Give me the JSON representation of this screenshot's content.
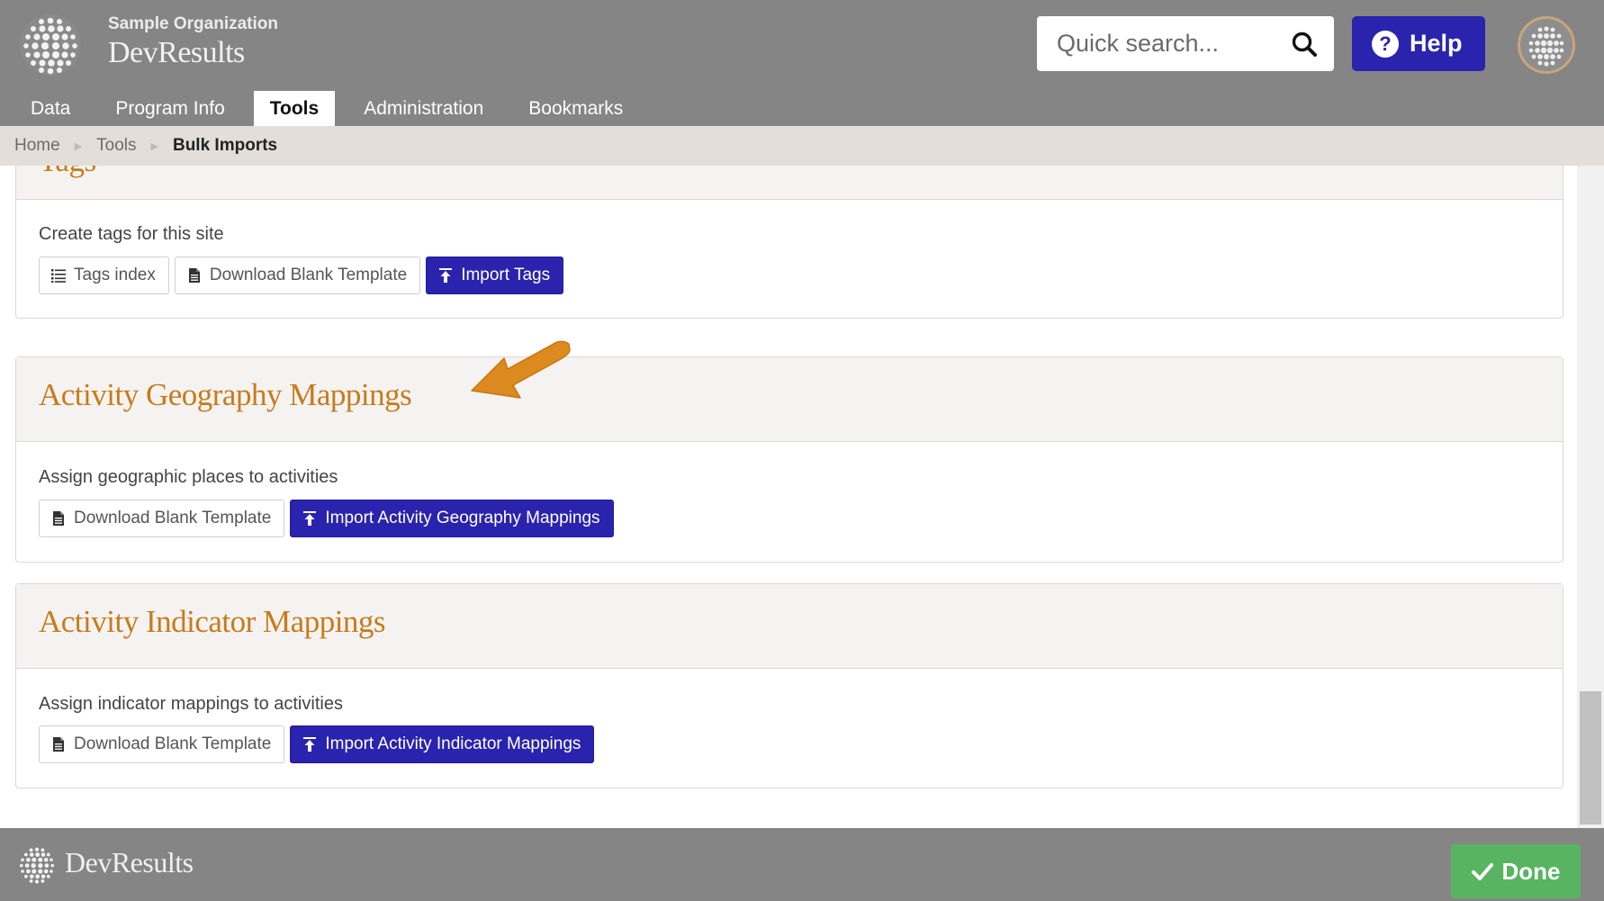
{
  "header": {
    "org_name": "Sample Organization",
    "app_name": "DevResults",
    "search_placeholder": "Quick search...",
    "help_label": "Help",
    "help_icon_glyph": "?"
  },
  "nav": {
    "tabs": [
      {
        "label": "Data",
        "active": false
      },
      {
        "label": "Program Info",
        "active": false
      },
      {
        "label": "Tools",
        "active": true
      },
      {
        "label": "Administration",
        "active": false
      },
      {
        "label": "Bookmarks",
        "active": false
      }
    ]
  },
  "breadcrumb": {
    "items": [
      "Home",
      "Tools",
      "Bulk Imports"
    ]
  },
  "sections": [
    {
      "title": "Tags",
      "description": "Create tags for this site",
      "buttons": [
        {
          "label": "Tags index",
          "icon": "list-icon",
          "style": "default"
        },
        {
          "label": "Download Blank Template",
          "icon": "file-icon",
          "style": "default"
        },
        {
          "label": "Import Tags",
          "icon": "upload-icon",
          "style": "primary"
        }
      ]
    },
    {
      "title": "Activity Geography Mappings",
      "description": "Assign geographic places to activities",
      "buttons": [
        {
          "label": "Download Blank Template",
          "icon": "file-icon",
          "style": "default"
        },
        {
          "label": "Import Activity Geography Mappings",
          "icon": "upload-icon",
          "style": "primary"
        }
      ]
    },
    {
      "title": "Activity Indicator Mappings",
      "description": "Assign indicator mappings to activities",
      "buttons": [
        {
          "label": "Download Blank Template",
          "icon": "file-icon",
          "style": "default"
        },
        {
          "label": "Import Activity Indicator Mappings",
          "icon": "upload-icon",
          "style": "primary"
        }
      ]
    }
  ],
  "footer": {
    "app_name": "DevResults",
    "done_label": "Done"
  },
  "colors": {
    "header_bg": "#858585",
    "primary": "#2a23ad",
    "section_title": "#c77b1b",
    "breadcrumb_bg": "#e3ded9",
    "done_green": "#59b461",
    "arrow": "#dc8a1f"
  }
}
